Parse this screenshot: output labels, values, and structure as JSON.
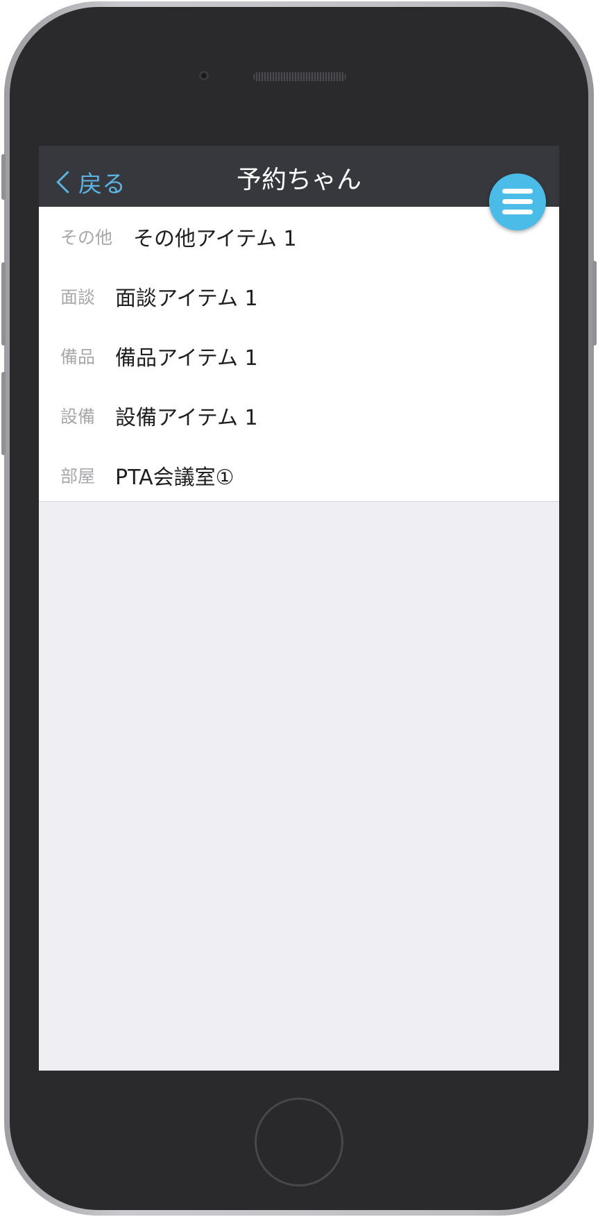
{
  "navbar": {
    "back_label": "戻る",
    "title": "予約ちゃん"
  },
  "menu_button": {
    "icon": "hamburger-menu-icon",
    "color": "#4bbbe8"
  },
  "rows": [
    {
      "label": "その他",
      "value": "その他アイテム 1"
    },
    {
      "label": "面談",
      "value": "面談アイテム 1"
    },
    {
      "label": "備品",
      "value": "備品アイテム 1"
    },
    {
      "label": "設備",
      "value": "設備アイテム 1"
    },
    {
      "label": "部屋",
      "value": "PTA会議室①"
    }
  ],
  "colors": {
    "navbar_bg": "#37383d",
    "accent": "#5bb4e2",
    "screen_bg": "#efeff3"
  }
}
